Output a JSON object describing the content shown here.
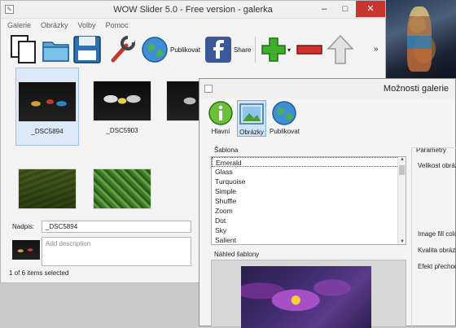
{
  "main_window": {
    "title": "WOW Slider 5.0 - Free version - galerka",
    "menu": [
      "Galerie",
      "Obrázky",
      "Volby",
      "Pomoc"
    ],
    "toolbar": {
      "publish_label": "Publikovat",
      "share_label": "Share",
      "overflow": "»"
    },
    "thumbnails": [
      {
        "caption": "_DSC5894",
        "selected": true
      },
      {
        "caption": "_DSC5903",
        "selected": false
      },
      {
        "caption": "",
        "selected": false
      },
      {
        "caption": "",
        "selected": false
      },
      {
        "caption": "",
        "selected": false
      }
    ],
    "properties": {
      "caption_label": "Nadpis:",
      "caption_value": "_DSC5894",
      "description_placeholder": "Add description"
    },
    "status": "1 of 6 items selected"
  },
  "dialog": {
    "title": "Možnosti galerie",
    "tools": [
      {
        "label": "Hlavní",
        "icon": "info-icon",
        "active": false
      },
      {
        "label": "Obrázky",
        "icon": "image-icon",
        "active": true
      },
      {
        "label": "Publikovat",
        "icon": "globe-icon",
        "active": false
      }
    ],
    "template_group": "Šablona",
    "templates": [
      "Emerald",
      "Glass",
      "Turquoise",
      "Simple",
      "Shuffle",
      "Zoom",
      "Dot",
      "Sky",
      "Salient"
    ],
    "selected_template": "Emerald",
    "preview_group": "Náhled šablony",
    "params_group": "Parametry",
    "params": [
      "Velikost obrázk",
      "Image fill color",
      "Kvalita obrázk",
      "Efekt přechod"
    ]
  },
  "colors": {
    "close_button": "#c7372f",
    "selection": "#dbe9f8",
    "accent_green": "#3fae2a",
    "accent_red": "#d13030"
  }
}
